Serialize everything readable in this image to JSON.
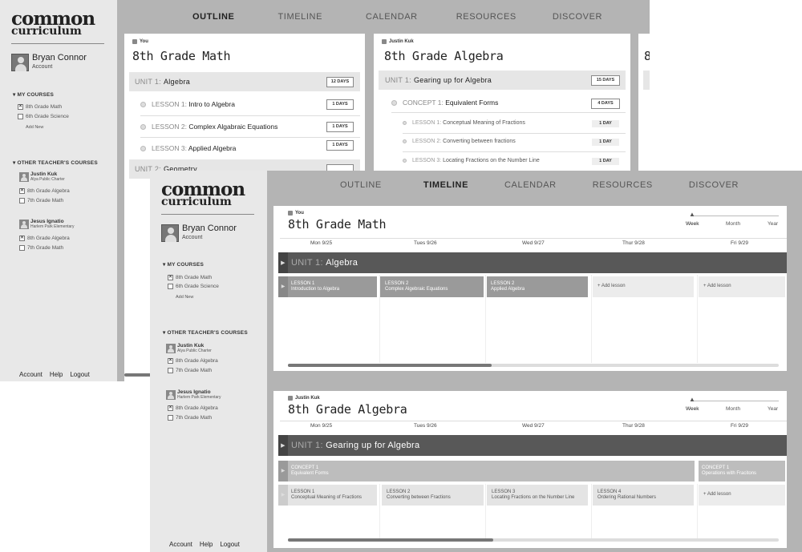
{
  "brand": {
    "line1": "common",
    "line2": "curriculum"
  },
  "user": {
    "name": "Bryan Connor",
    "sub": "Account"
  },
  "sidebar": {
    "my_courses_label": "MY COURSES",
    "my_courses": [
      {
        "label": "8th Grade Math",
        "checked": true
      },
      {
        "label": "6th Grade Science",
        "checked": false
      }
    ],
    "add_new": "Add New",
    "other_label": "OTHER TEACHER'S COURSES",
    "teachers": [
      {
        "name": "Justin Kuk",
        "school": "Alya Public Charter",
        "courses": [
          {
            "label": "8th Grade Algebra",
            "checked": true
          },
          {
            "label": "7th Grade Math",
            "checked": false
          }
        ]
      },
      {
        "name": "Jesus Ignatio",
        "school": "Harlem Park Elementary",
        "courses": [
          {
            "label": "8th Grade Algebra",
            "checked": true
          },
          {
            "label": "7th Grade Math",
            "checked": false
          }
        ]
      }
    ],
    "footer": [
      "Account",
      "Help",
      "Logout"
    ]
  },
  "nav": [
    "OUTLINE",
    "TIMELINE",
    "CALENDAR",
    "RESOURCES",
    "DISCOVER"
  ],
  "outline": {
    "panel1": {
      "who": "You",
      "title": "8th Grade Math",
      "unit": {
        "prefix": "UNIT 1:",
        "name": "Algebra",
        "days": "12 DAYS"
      },
      "lessons": [
        {
          "prefix": "LESSON 1:",
          "name": "Intro to Algebra",
          "days": "1 DAYS"
        },
        {
          "prefix": "LESSON 2:",
          "name": "Complex Algabraic Equations",
          "days": "1 DAYS"
        },
        {
          "prefix": "LESSON 3:",
          "name": "Applied Algebra",
          "days": "1 DAYS"
        }
      ],
      "unit2": {
        "prefix": "UNIT 2:",
        "name": "Geometry"
      }
    },
    "panel2": {
      "who": "Justin Kuk",
      "title": "8th Grade Algebra",
      "unit": {
        "prefix": "UNIT 1:",
        "name": "Gearing up for Algebra",
        "days": "15 DAYS"
      },
      "concept": {
        "prefix": "CONCEPT 1:",
        "name": "Equivalent Forms",
        "days": "4 DAYS"
      },
      "lessons": [
        {
          "prefix": "LESSON 1:",
          "name": "Conceptual Meaning of Fractions",
          "days": "1 DAY"
        },
        {
          "prefix": "LESSON 2:",
          "name": "Converting between fractions",
          "days": "1 DAY"
        },
        {
          "prefix": "LESSON 3:",
          "name": "Locating Fractions on the Number Line",
          "days": "1 DAY"
        }
      ]
    },
    "panel3": {
      "title": "8"
    }
  },
  "timeline": {
    "scale": [
      "Week",
      "Month",
      "Year"
    ],
    "days": [
      "Mon 9/25",
      "Tues 9/26",
      "Wed 9/27",
      "Thur 9/28",
      "Fri 9/29"
    ],
    "panel1": {
      "who": "You",
      "title": "8th Grade Math",
      "unit": {
        "prefix": "UNIT 1:",
        "name": "Algebra"
      },
      "cells": [
        {
          "top": "LESSON 1",
          "bottom": "Introduction to Algebra"
        },
        {
          "top": "LESSON 2",
          "bottom": "Complex Algebraic Equations"
        },
        {
          "top": "LESSON 2",
          "bottom": "Applied Algebra"
        },
        {
          "top": "+ Add lesson",
          "bottom": ""
        },
        {
          "top": "+ Add lesson",
          "bottom": ""
        }
      ]
    },
    "panel2": {
      "who": "Justin Kuk",
      "title": "8th Grade Algebra",
      "unit": {
        "prefix": "UNIT 1:",
        "name": "Gearing up for Algebra"
      },
      "concepts": [
        {
          "top": "CONCEPT 1",
          "bottom": "Equivalent Forms"
        },
        {
          "top": "CONCEPT 1",
          "bottom": "Operations with Fracitons"
        }
      ],
      "cells": [
        {
          "top": "LESSON 1",
          "bottom": "Conceptual Meaning of Fractions"
        },
        {
          "top": "LESSON 2",
          "bottom": "Converting between Fractions"
        },
        {
          "top": "LESSON 3",
          "bottom": "Locating Fractions on the Number Line"
        },
        {
          "top": "LESSON 4",
          "bottom": "Ordering Rational Numbers"
        },
        {
          "top": "+ Add lesson",
          "bottom": ""
        }
      ]
    }
  },
  "colors": {
    "sidebar": "#e8e8e8",
    "frame": "#b4b4b4",
    "unit_bar": "#585858",
    "lesson_cell": "#9a9a9a"
  }
}
